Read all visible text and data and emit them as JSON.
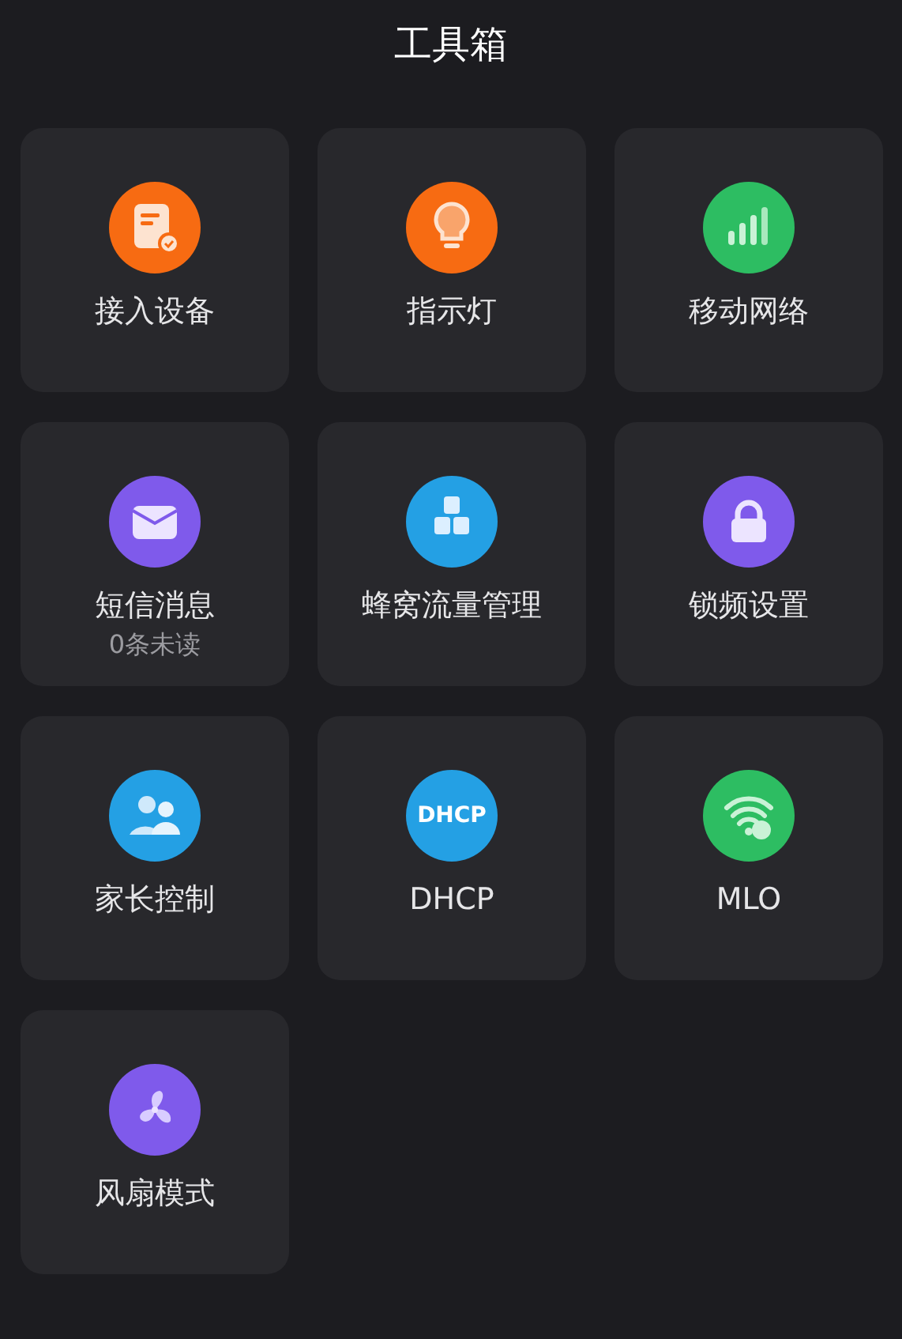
{
  "header": {
    "title": "工具箱"
  },
  "tools": [
    {
      "label": "接入设备",
      "color": "#f76b12"
    },
    {
      "label": "指示灯",
      "color": "#f76b12"
    },
    {
      "label": "移动网络",
      "color": "#2dbd62"
    },
    {
      "label": "短信消息",
      "subtitle": "0条未读",
      "color": "#7f5aeb"
    },
    {
      "label": "蜂窝流量管理",
      "color": "#24a0e4"
    },
    {
      "label": "锁频设置",
      "color": "#7f5aeb"
    },
    {
      "label": "家长控制",
      "color": "#24a0e4"
    },
    {
      "label": "DHCP",
      "icon_text": "DHCP",
      "color": "#24a0e4"
    },
    {
      "label": "MLO",
      "color": "#2dbd62"
    },
    {
      "label": "风扇模式",
      "color": "#7f5aeb"
    }
  ]
}
